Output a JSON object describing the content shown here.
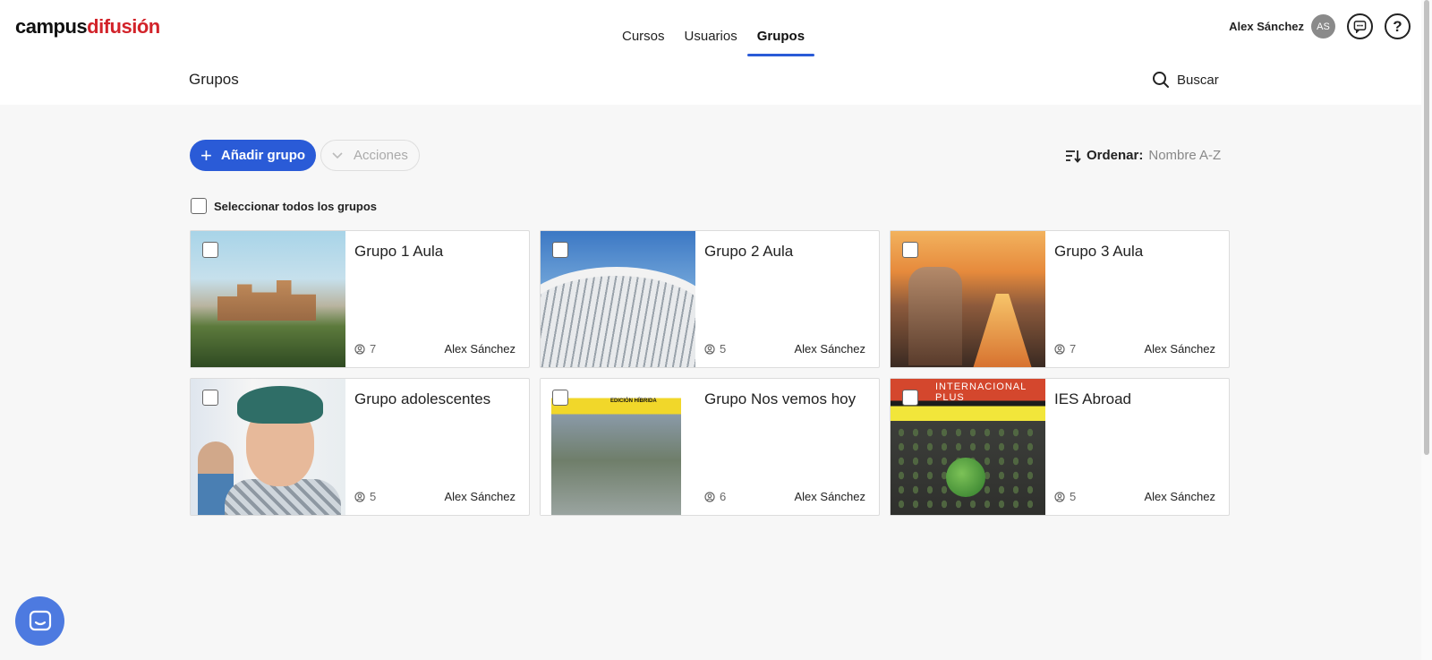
{
  "brand": {
    "part1": "campus",
    "part2": "difusión"
  },
  "nav": {
    "items": [
      {
        "label": "Cursos",
        "active": false
      },
      {
        "label": "Usuarios",
        "active": false
      },
      {
        "label": "Grupos",
        "active": true
      }
    ]
  },
  "user": {
    "name": "Alex Sánchez",
    "initials": "AS",
    "help": "?"
  },
  "subheader": {
    "title": "Grupos",
    "search_label": "Buscar"
  },
  "toolbar": {
    "add_label": "Añadir grupo",
    "actions_label": "Acciones",
    "sort_label": "Ordenar:",
    "sort_value": "Nombre A-Z",
    "select_all_label": "Seleccionar todos los grupos"
  },
  "groups": [
    {
      "title": "Grupo 1 Aula",
      "members": "7",
      "owner": "Alex Sánchez",
      "image": "alhambra-photo"
    },
    {
      "title": "Grupo 2 Aula",
      "members": "5",
      "owner": "Alex Sánchez",
      "image": "valencia-photo"
    },
    {
      "title": "Grupo 3 Aula",
      "members": "7",
      "owner": "Alex Sánchez",
      "image": "madrid-photo"
    },
    {
      "title": "Grupo adolescentes",
      "members": "5",
      "owner": "Alex Sánchez",
      "image": "teen-photo"
    },
    {
      "title": "Grupo Nos vemos hoy",
      "members": "6",
      "owner": "Alex Sánchez",
      "image": "book-cover-hoy"
    },
    {
      "title": "IES Abroad",
      "members": "5",
      "owner": "Alex Sánchez",
      "image": "book-cover-internacional-plus"
    }
  ],
  "book_text": {
    "hoy_tag": "EDICIÓN HÍBRIDA",
    "intl_title": "INTERNACIONAL PLUS"
  },
  "colors": {
    "accent": "#2a5bd7",
    "brand_red": "#d2232a",
    "background": "#f7f7f7"
  }
}
